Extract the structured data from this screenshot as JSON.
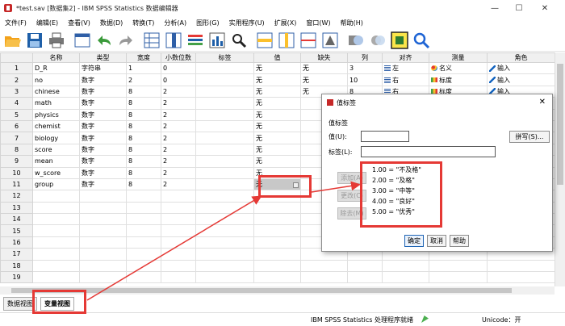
{
  "window": {
    "title": "*test.sav [数据集2] - IBM SPSS Statistics 数据编辑器",
    "min": "—",
    "max": "☐",
    "close": "✕"
  },
  "menu": [
    "文件(F)",
    "编辑(E)",
    "查看(V)",
    "数据(D)",
    "转换(T)",
    "分析(A)",
    "图形(G)",
    "实用程序(U)",
    "扩展(X)",
    "窗口(W)",
    "帮助(H)"
  ],
  "toolbar": [
    "open-icon",
    "save-icon",
    "print-icon",
    "recall-dialog-icon",
    "undo-icon",
    "redo-icon",
    "goto-case-icon",
    "goto-variable-icon",
    "variables-icon",
    "run-descriptives-icon",
    "find-icon",
    "insert-cases-icon",
    "insert-variable-icon",
    "split-file-icon",
    "weight-cases-icon",
    "select-cases-icon",
    "value-labels-icon",
    "use-sets-icon",
    "show-all-variables-icon",
    "spelling-icon"
  ],
  "grid": {
    "headers": [
      "",
      "名称",
      "类型",
      "宽度",
      "小数位数",
      "标签",
      "值",
      "缺失",
      "列",
      "对齐",
      "测量",
      "角色"
    ],
    "rows": [
      {
        "n": "1",
        "name": "D_R",
        "type": "字符串",
        "width": "1",
        "dec": "0",
        "label": "",
        "values": "无",
        "missing": "无",
        "cols": "3",
        "align": "左",
        "measure": "名义",
        "role": "输入",
        "measure_kind": "nominal"
      },
      {
        "n": "2",
        "name": "no",
        "type": "数字",
        "width": "2",
        "dec": "0",
        "label": "",
        "values": "无",
        "missing": "无",
        "cols": "10",
        "align": "右",
        "measure": "标度",
        "role": "输入",
        "measure_kind": "scale"
      },
      {
        "n": "3",
        "name": "chinese",
        "type": "数字",
        "width": "8",
        "dec": "2",
        "label": "",
        "values": "无",
        "missing": "无",
        "cols": "8",
        "align": "右",
        "measure": "标度",
        "role": "输入",
        "measure_kind": "scale"
      },
      {
        "n": "4",
        "name": "math",
        "type": "数字",
        "width": "8",
        "dec": "2",
        "label": "",
        "values": "无",
        "missing": "",
        "cols": "",
        "align": "",
        "measure": "",
        "role": "",
        "measure_kind": ""
      },
      {
        "n": "5",
        "name": "physics",
        "type": "数字",
        "width": "8",
        "dec": "2",
        "label": "",
        "values": "无",
        "missing": "",
        "cols": "",
        "align": "",
        "measure": "",
        "role": "",
        "measure_kind": ""
      },
      {
        "n": "6",
        "name": "chemist",
        "type": "数字",
        "width": "8",
        "dec": "2",
        "label": "",
        "values": "无",
        "missing": "",
        "cols": "",
        "align": "",
        "measure": "",
        "role": "",
        "measure_kind": ""
      },
      {
        "n": "7",
        "name": "biology",
        "type": "数字",
        "width": "8",
        "dec": "2",
        "label": "",
        "values": "无",
        "missing": "",
        "cols": "",
        "align": "",
        "measure": "",
        "role": "",
        "measure_kind": ""
      },
      {
        "n": "8",
        "name": "score",
        "type": "数字",
        "width": "8",
        "dec": "2",
        "label": "",
        "values": "无",
        "missing": "",
        "cols": "",
        "align": "",
        "measure": "",
        "role": "",
        "measure_kind": ""
      },
      {
        "n": "9",
        "name": "mean",
        "type": "数字",
        "width": "8",
        "dec": "2",
        "label": "",
        "values": "无",
        "missing": "",
        "cols": "",
        "align": "",
        "measure": "",
        "role": "",
        "measure_kind": ""
      },
      {
        "n": "10",
        "name": "w_score",
        "type": "数字",
        "width": "8",
        "dec": "2",
        "label": "",
        "values": "无",
        "missing": "",
        "cols": "",
        "align": "",
        "measure": "",
        "role": "",
        "measure_kind": ""
      },
      {
        "n": "11",
        "name": "group",
        "type": "数字",
        "width": "8",
        "dec": "2",
        "label": "",
        "values": "无",
        "missing": "",
        "cols": "",
        "align": "",
        "measure": "",
        "role": "",
        "measure_kind": ""
      }
    ],
    "empty_rows": [
      "12",
      "13",
      "14",
      "15",
      "16",
      "17",
      "18",
      "19"
    ],
    "selected_row": "11"
  },
  "tabs": {
    "data_view": "数据视图",
    "variable_view": "变量视图"
  },
  "status": {
    "processor": "IBM SPSS Statistics 处理程序就绪",
    "unicode": "Unicode：开"
  },
  "dialog": {
    "title": "值标签",
    "group_label": "值标签",
    "value_label": "值(U):",
    "label_label": "标签(L):",
    "value_input": "",
    "label_input": "",
    "spelling": "拼写(S)...",
    "add": "添加(A)",
    "change": "更改(C)",
    "remove": "除去(M)",
    "list": [
      "1.00 = \"不及格\"",
      "2.00 = \"及格\"",
      "3.00 = \"中等\"",
      "4.00 = \"良好\"",
      "5.00 = \"优秀\""
    ],
    "ok": "确定",
    "cancel": "取消",
    "help": "帮助"
  },
  "colors": {
    "highlight": "#e53935",
    "accent": "#1e64b4",
    "selected_cell": "#c8c8c8"
  }
}
